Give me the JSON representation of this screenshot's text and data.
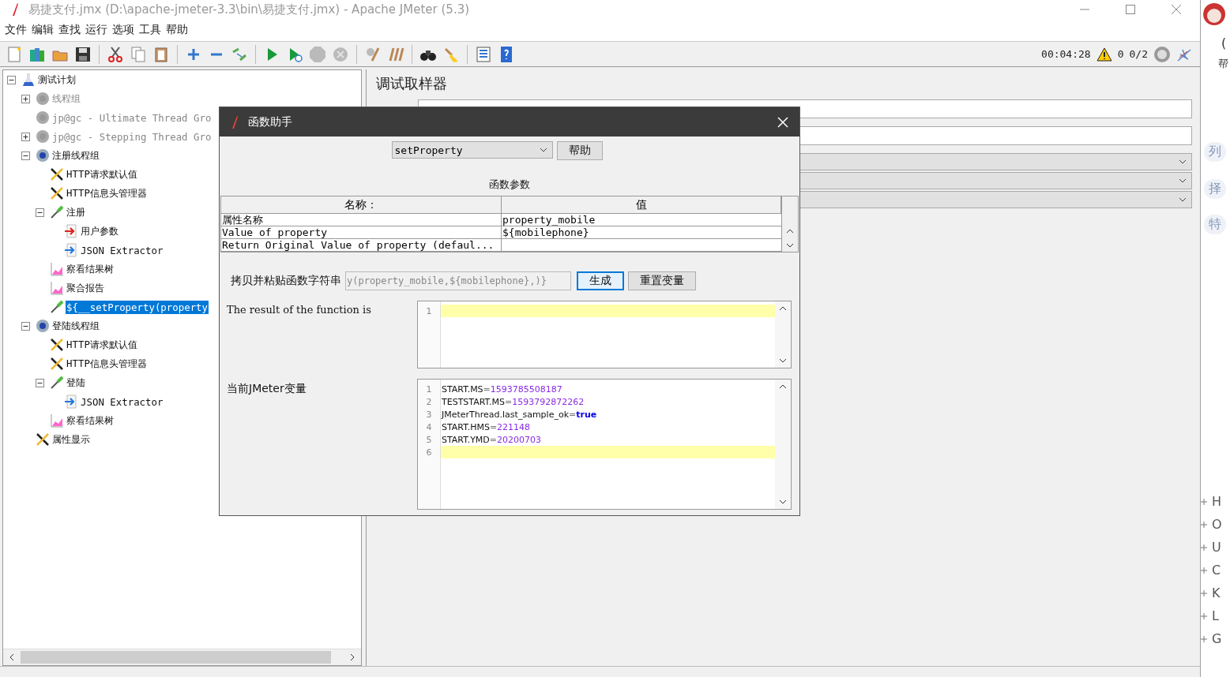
{
  "window": {
    "title": "易捷支付.jmx (D:\\apache-jmeter-3.3\\bin\\易捷支付.jmx) - Apache JMeter (5.3)",
    "active": false
  },
  "menu": [
    "文件",
    "编辑",
    "查找",
    "运行",
    "选项",
    "工具",
    "帮助"
  ],
  "toolbar": [
    [
      {
        "kind": "new",
        "disabled": false
      },
      {
        "kind": "templates",
        "disabled": false
      },
      {
        "kind": "open",
        "disabled": false
      },
      {
        "kind": "save",
        "disabled": false
      }
    ],
    [
      {
        "kind": "cut",
        "disabled": false
      },
      {
        "kind": "copy",
        "disabled": false
      },
      {
        "kind": "paste",
        "disabled": false
      }
    ],
    [
      {
        "kind": "expand",
        "disabled": false
      },
      {
        "kind": "collapse",
        "disabled": false
      },
      {
        "kind": "toggle",
        "disabled": false
      }
    ],
    [
      {
        "kind": "start",
        "disabled": false
      },
      {
        "kind": "start-no-pause",
        "disabled": false
      },
      {
        "kind": "stop",
        "disabled": true
      },
      {
        "kind": "shutdown",
        "disabled": true
      }
    ],
    [
      {
        "kind": "clear",
        "disabled": false
      },
      {
        "kind": "clear-all",
        "disabled": false
      }
    ],
    [
      {
        "kind": "search",
        "disabled": false
      },
      {
        "kind": "reset-search",
        "disabled": false
      }
    ],
    [
      {
        "kind": "function-helper",
        "disabled": false
      },
      {
        "kind": "help",
        "disabled": false
      }
    ]
  ],
  "status": {
    "time": "00:04:28",
    "errors": "0",
    "threads": "0/2"
  },
  "tree": [
    {
      "label": "测试计划",
      "kind": "plan",
      "expanded": true,
      "disabled": false,
      "selected": false,
      "children": [
        {
          "label": "线程组",
          "kind": "thread-group",
          "expanded": false,
          "disabled": true,
          "selected": false
        },
        {
          "label": "jp@gc - Ultimate Thread Gro",
          "kind": "thread-group",
          "disabled": true,
          "selected": false
        },
        {
          "label": "jp@gc - Stepping Thread Gro",
          "kind": "thread-group",
          "expanded": false,
          "disabled": true,
          "selected": false
        },
        {
          "label": "注册线程组",
          "kind": "thread-group",
          "expanded": true,
          "disabled": false,
          "selected": false,
          "children": [
            {
              "label": "HTTP请求默认值",
              "kind": "config",
              "disabled": false,
              "selected": false
            },
            {
              "label": "HTTP信息头管理器",
              "kind": "config",
              "disabled": false,
              "selected": false
            },
            {
              "label": "注册",
              "kind": "sampler",
              "expanded": true,
              "disabled": false,
              "selected": false,
              "children": [
                {
                  "label": "用户参数",
                  "kind": "preprocessor",
                  "disabled": false,
                  "selected": false
                },
                {
                  "label": "JSON Extractor",
                  "kind": "extractor",
                  "disabled": false,
                  "selected": false
                }
              ]
            },
            {
              "label": "察看结果树",
              "kind": "listener",
              "disabled": false,
              "selected": false
            },
            {
              "label": "聚合报告",
              "kind": "listener",
              "disabled": false,
              "selected": false
            },
            {
              "label": "${__setProperty(property",
              "kind": "sampler",
              "disabled": false,
              "selected": true
            }
          ]
        },
        {
          "label": "登陆线程组",
          "kind": "thread-group",
          "expanded": true,
          "disabled": false,
          "selected": false,
          "children": [
            {
              "label": "HTTP请求默认值",
              "kind": "config",
              "disabled": false,
              "selected": false
            },
            {
              "label": "HTTP信息头管理器",
              "kind": "config",
              "disabled": false,
              "selected": false
            },
            {
              "label": "登陆",
              "kind": "sampler",
              "expanded": true,
              "disabled": false,
              "selected": false,
              "children": [
                {
                  "label": "JSON Extractor",
                  "kind": "extractor",
                  "disabled": false,
                  "selected": false
                }
              ]
            },
            {
              "label": "察看结果树",
              "kind": "listener",
              "disabled": false,
              "selected": false
            }
          ]
        },
        {
          "label": "属性显示",
          "kind": "config",
          "disabled": false,
          "selected": false
        }
      ]
    }
  ],
  "sampler_panel": {
    "title": "调试取样器"
  },
  "function_helper": {
    "title": "函数助手",
    "function": "setProperty",
    "help_button": "帮助",
    "params_label": "函数参数",
    "columns": [
      "名称：",
      "值"
    ],
    "rows": [
      {
        "name": "属性名称",
        "value": "property_mobile"
      },
      {
        "name": "Value of property",
        "value": "${mobilephone}"
      },
      {
        "name": "Return Original Value of property (defaul..."
      }
    ],
    "copy_label": "拷贝并粘贴函数字符串",
    "function_string": "y(property_mobile,${mobilephone},)}",
    "generate_button": "生成",
    "reset_button": "重置变量",
    "result_label": "The result of the function is",
    "result_lines": [
      {
        "number": "1",
        "highlighted": true
      }
    ],
    "vars_label": "当前JMeter变量",
    "var_lines": [
      {
        "number": "1",
        "key": "START.MS",
        "sep": "=",
        "value": "1593785508187",
        "kind": "number",
        "highlighted": false
      },
      {
        "number": "2",
        "key": "TESTSTART.MS",
        "sep": "=",
        "value": "1593792872262",
        "kind": "number",
        "highlighted": false
      },
      {
        "number": "3",
        "key": "JMeterThread.last_sample_ok",
        "sep": "=",
        "value": "true",
        "kind": "boolean",
        "highlighted": false
      },
      {
        "number": "4",
        "key": "START.HMS",
        "sep": "=",
        "value": "221148",
        "kind": "number",
        "highlighted": false
      },
      {
        "number": "5",
        "key": "START.YMD",
        "sep": "=",
        "value": "20200703",
        "kind": "number",
        "highlighted": false
      },
      {
        "number": "6",
        "highlighted": true
      }
    ]
  },
  "right_strip": {
    "fragments": [
      "(",
      "帮",
      "列",
      "择",
      "特"
    ],
    "index_letters": [
      "H",
      "O",
      "U",
      "C",
      "K",
      "L",
      "G"
    ]
  }
}
